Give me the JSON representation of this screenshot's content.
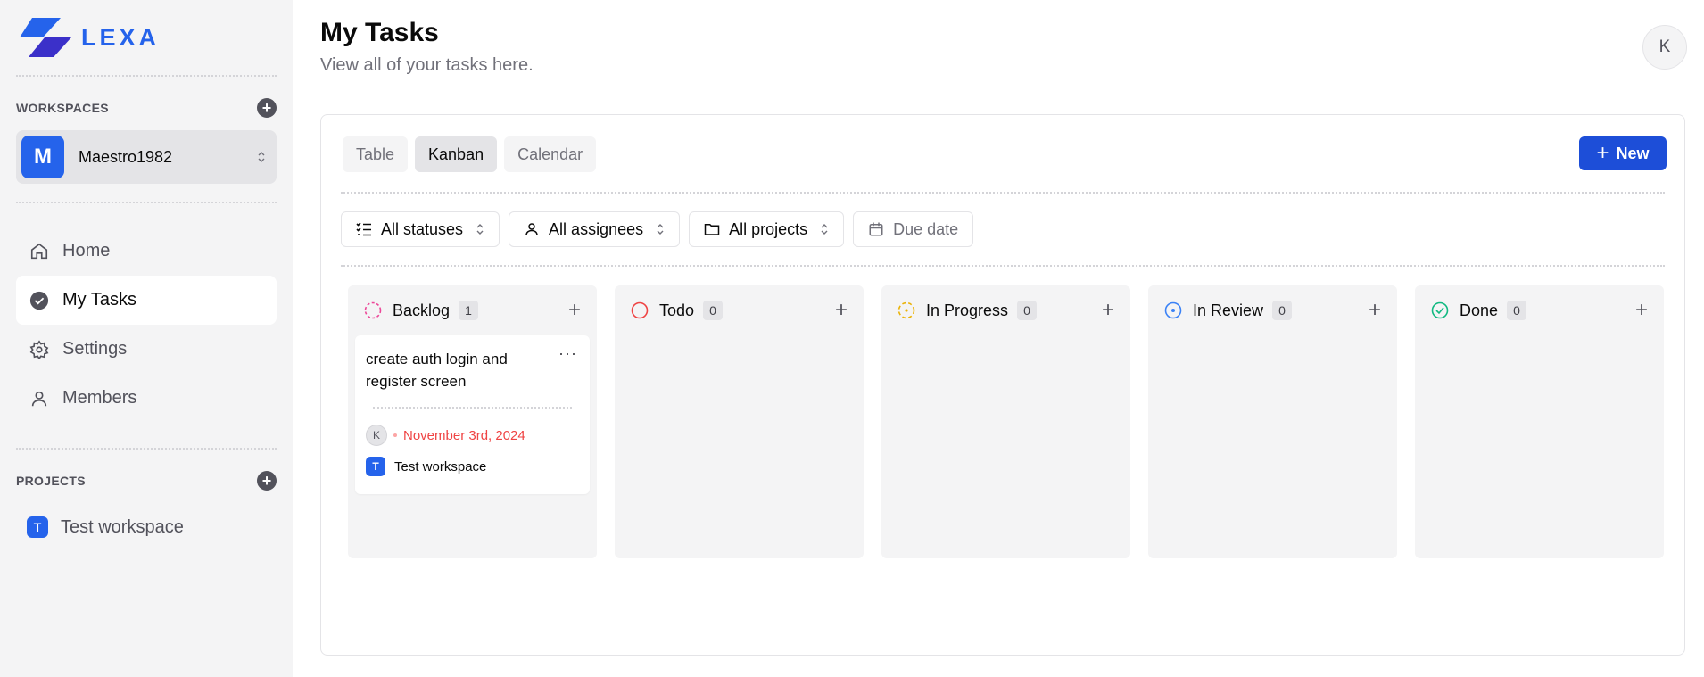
{
  "app": {
    "name": "LEXA",
    "brand_color": "#2563eb"
  },
  "sidebar": {
    "workspaces_title": "WORKSPACES",
    "workspace": {
      "initial": "M",
      "name": "Maestro1982"
    },
    "nav": [
      {
        "label": "Home",
        "icon": "home-icon"
      },
      {
        "label": "My Tasks",
        "icon": "check-circle-icon",
        "active": true
      },
      {
        "label": "Settings",
        "icon": "gear-icon"
      },
      {
        "label": "Members",
        "icon": "user-icon"
      }
    ],
    "projects_title": "PROJECTS",
    "projects": [
      {
        "initial": "T",
        "name": "Test workspace"
      }
    ]
  },
  "header": {
    "title": "My Tasks",
    "subtitle": "View all of your tasks here.",
    "user_initial": "K"
  },
  "views": {
    "tabs": [
      {
        "label": "Table"
      },
      {
        "label": "Kanban",
        "active": true
      },
      {
        "label": "Calendar"
      }
    ],
    "new_label": "New"
  },
  "filters": {
    "status": "All statuses",
    "assignees": "All assignees",
    "projects": "All projects",
    "due_date": "Due date"
  },
  "board": {
    "columns": [
      {
        "title": "Backlog",
        "count": "1",
        "color": "#ec4899",
        "icon": "dashed-circle-icon"
      },
      {
        "title": "Todo",
        "count": "0",
        "color": "#ef4444",
        "icon": "circle-icon"
      },
      {
        "title": "In Progress",
        "count": "0",
        "color": "#eab308",
        "icon": "dotted-circle-icon"
      },
      {
        "title": "In Review",
        "count": "0",
        "color": "#3b82f6",
        "icon": "circle-dot-icon"
      },
      {
        "title": "Done",
        "count": "0",
        "color": "#10b981",
        "icon": "circle-check-icon"
      }
    ],
    "card": {
      "title": "create auth login and register screen",
      "assignee_initial": "K",
      "due_date": "November 3rd, 2024",
      "project_initial": "T",
      "project_name": "Test workspace"
    }
  }
}
